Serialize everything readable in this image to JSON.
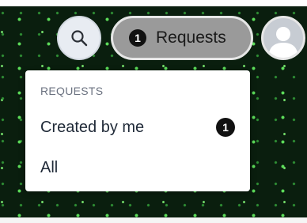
{
  "header": {
    "search_icon": "search-icon",
    "requests_button": {
      "label": "Requests",
      "badge_count": "1"
    },
    "avatar_icon": "user-avatar-icon"
  },
  "dropdown": {
    "section_title": "REQUESTS",
    "items": [
      {
        "label": "Created by me",
        "badge_count": "1"
      },
      {
        "label": "All"
      }
    ]
  },
  "colors": {
    "background": "#0a1e0e",
    "dots": "#5dde5a",
    "pill": "#9a9a9a",
    "badge": "#111111",
    "menu": "#ffffff"
  }
}
